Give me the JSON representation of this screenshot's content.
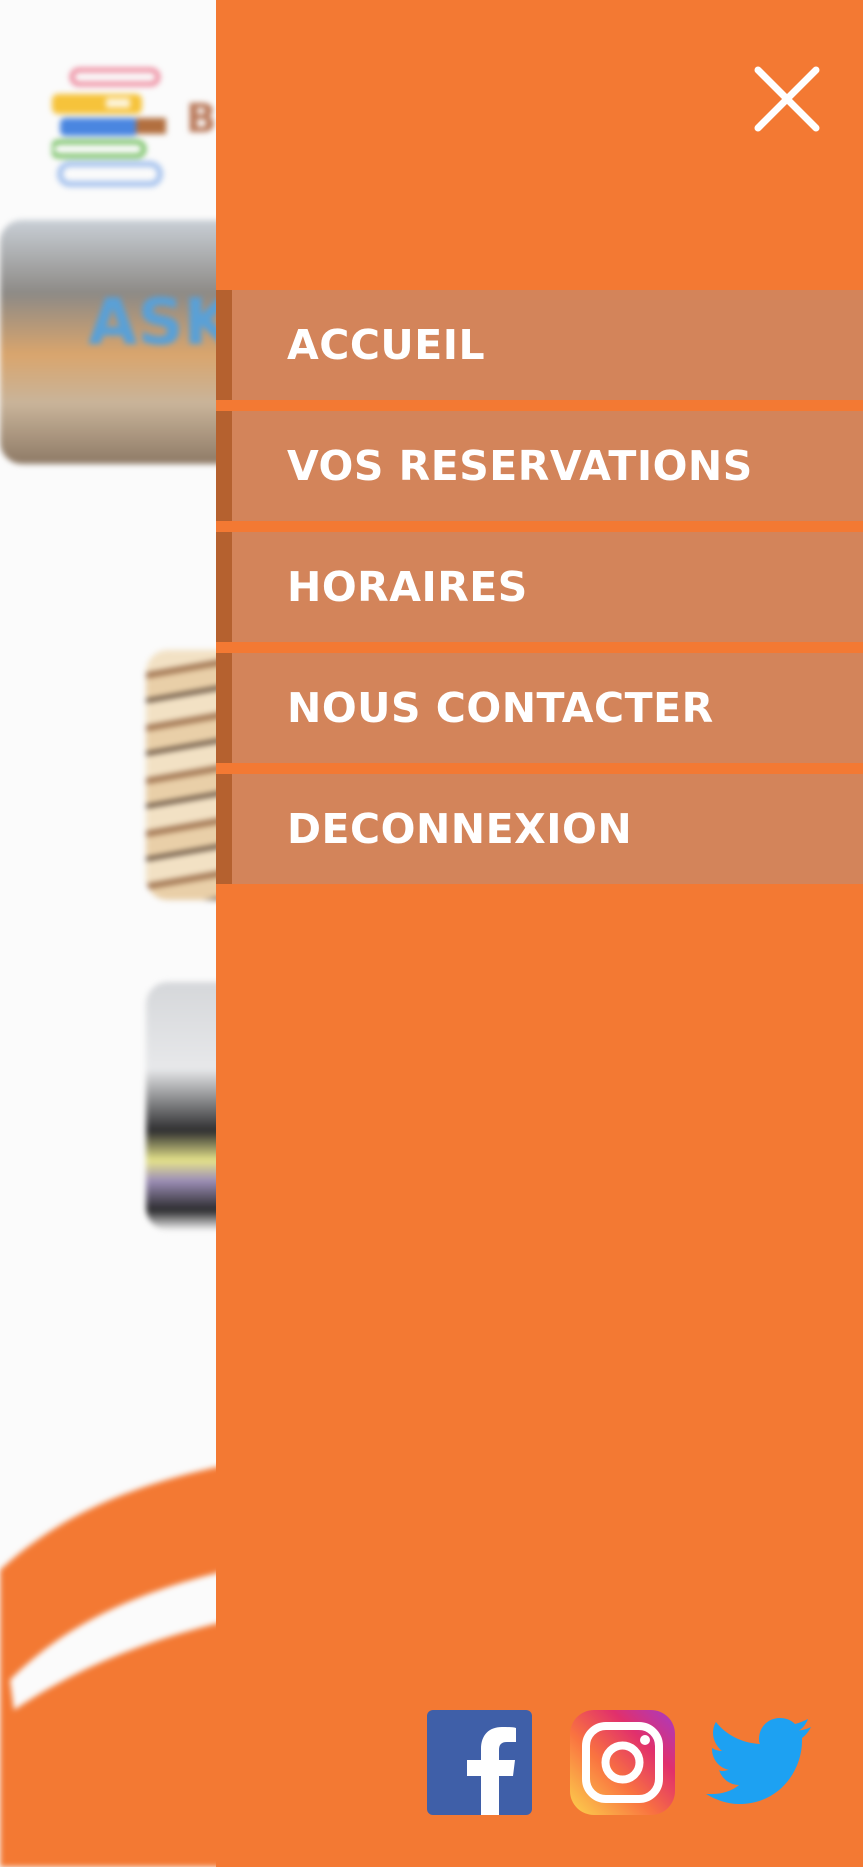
{
  "background_page": {
    "logo_text": "B",
    "banner_text": "ASK"
  },
  "drawer": {
    "close_label": "Fermer",
    "menu": [
      {
        "label": "ACCUEIL"
      },
      {
        "label": "VOS RESERVATIONS"
      },
      {
        "label": "HORAIRES"
      },
      {
        "label": "NOUS CONTACTER"
      },
      {
        "label": "DECONNEXION"
      }
    ],
    "social": [
      {
        "name": "facebook",
        "icon": "facebook-icon"
      },
      {
        "name": "instagram",
        "icon": "instagram-icon"
      },
      {
        "name": "twitter",
        "icon": "twitter-icon"
      }
    ]
  },
  "colors": {
    "drawer_background": "#f37933",
    "menu_item_background": "#d3845a",
    "menu_item_border": "#b5612f",
    "menu_text": "#ffffff",
    "facebook_blue": "#3f5fa8",
    "twitter_blue": "#1da1f2"
  }
}
